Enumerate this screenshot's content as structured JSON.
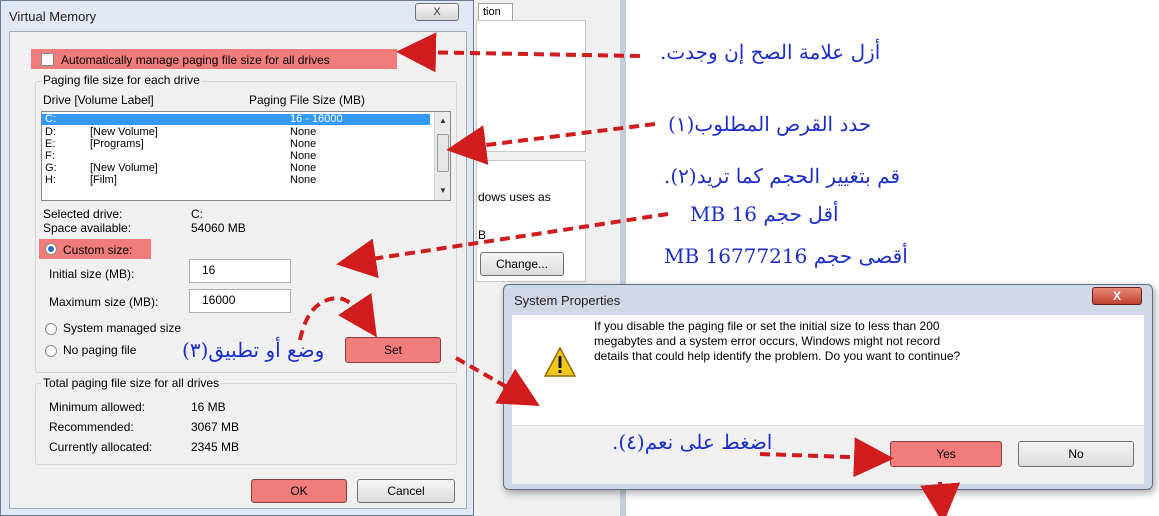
{
  "background_window": {
    "tab_label": "tion",
    "text_fragments": [
      "s",
      "dows uses as",
      "B"
    ],
    "change_button": "Change..."
  },
  "virtual_memory": {
    "title": "Virtual Memory",
    "close_label": "X",
    "auto_manage_label": "Automatically manage paging file size for all drives",
    "auto_manage_checked": false,
    "per_drive_group": "Paging file size for each drive",
    "columns": {
      "drive": "Drive  [Volume Label]",
      "size": "Paging File Size (MB)"
    },
    "drives": [
      {
        "drive": "C:",
        "label": "",
        "size": "16 - 16000",
        "selected": true
      },
      {
        "drive": "D:",
        "label": "[New Volume]",
        "size": "None"
      },
      {
        "drive": "E:",
        "label": "[Programs]",
        "size": "None"
      },
      {
        "drive": "F:",
        "label": "",
        "size": "None"
      },
      {
        "drive": "G:",
        "label": "[New Volume]",
        "size": "None"
      },
      {
        "drive": "H:",
        "label": "[Film]",
        "size": "None"
      }
    ],
    "selected_drive_label": "Selected drive:",
    "selected_drive_value": "C:",
    "space_available_label": "Space available:",
    "space_available_value": "54060 MB",
    "custom_size_label": "Custom size:",
    "initial_size_label": "Initial size (MB):",
    "initial_size_value": "16",
    "maximum_size_label": "Maximum size (MB):",
    "maximum_size_value": "16000",
    "system_managed_label": "System managed size",
    "no_paging_label": "No paging file",
    "set_button": "Set",
    "totals_group": "Total paging file size for all drives",
    "minimum_label": "Minimum allowed:",
    "minimum_value": "16 MB",
    "recommended_label": "Recommended:",
    "recommended_value": "3067 MB",
    "allocated_label": "Currently allocated:",
    "allocated_value": "2345 MB",
    "ok_button": "OK",
    "cancel_button": "Cancel"
  },
  "system_properties": {
    "title": "System Properties",
    "close_label": "X",
    "warning_icon": "warning-icon",
    "message_line1": "If you disable the paging file or set the initial size to less than 200",
    "message_line2": "megabytes and a system error occurs, Windows might not record",
    "message_line3": "details that could help identify the problem. Do you want to continue?",
    "yes_button": "Yes",
    "no_button": "No"
  },
  "annotations": {
    "step_uncheck": "أزل علامة الصح إن وجدت.",
    "step1": "حدد القرص المطلوب(١)",
    "step2": "قم بتغيير الحجم كما تريد(٢).",
    "min_size": "أقل حجم 16 MB",
    "max_size": "أقصى حجم 16777216 MB",
    "step3": "وضع أو تطبيق(٣)",
    "step4": "اضغط على نعم(٤)."
  },
  "colors": {
    "highlight": "#f07c7c",
    "arrow": "#d01c1c",
    "annotation_text": "#1c2ec8",
    "selection": "#3399ff"
  }
}
